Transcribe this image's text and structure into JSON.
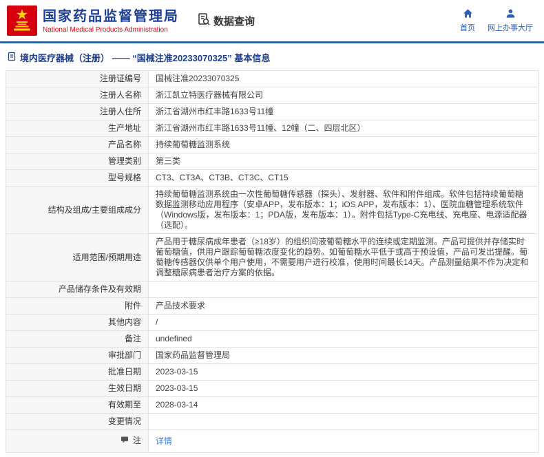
{
  "header": {
    "agency_cn": "国家药品监督管理局",
    "agency_en": "National Medical Products Administration",
    "data_query": "数据查询",
    "nav": {
      "home": "首页",
      "service_hall": "网上办事大厅"
    }
  },
  "breadcrumb": {
    "text": "境内医疗器械（注册） ——  “国械注准20233070325” 基本信息"
  },
  "table": {
    "rows": [
      {
        "label": "注册证编号",
        "value": "国械注准20233070325"
      },
      {
        "label": "注册人名称",
        "value": "浙江凯立特医疗器械有限公司"
      },
      {
        "label": "注册人住所",
        "value": "浙江省湖州市红丰路1633号11幢"
      },
      {
        "label": "生产地址",
        "value": "浙江省湖州市红丰路1633号11幢、12幢（二、四层北区）"
      },
      {
        "label": "产品名称",
        "value": "持续葡萄糖监测系统"
      },
      {
        "label": "管理类别",
        "value": "第三类"
      },
      {
        "label": "型号规格",
        "value": "CT3、CT3A、CT3B、CT3C、CT15"
      },
      {
        "label": "结构及组成/主要组成成分",
        "value": "持续葡萄糖监测系统由一次性葡萄糖传感器（探头）、发射器、软件和附件组成。软件包括持续葡萄糖数据监测移动应用程序（安卓APP，发布版本：1；iOS APP，发布版本：1）、医院血糖管理系统软件（Windows版，发布版本：1；PDA版，发布版本：1）。附件包括Type-C充电线、充电座、电源适配器（选配）。"
      },
      {
        "label": "适用范围/预期用途",
        "value": "产品用于糖尿病成年患者（≥18岁）的组织间液葡萄糖水平的连续或定期监测。产品可提供并存储实时葡萄糖值，供用户跟踪葡萄糖浓度变化的趋势。如葡萄糖水平低于或高于预设值，产品可发出提醒。葡萄糖传感器仅供单个用户使用，不需要用户进行校准，使用时间最长14天。产品测量结果不作为决定和调整糖尿病患者治疗方案的依据。"
      },
      {
        "label": "产品储存条件及有效期",
        "value": ""
      },
      {
        "label": "附件",
        "value": "产品技术要求"
      },
      {
        "label": "其他内容",
        "value": "/"
      },
      {
        "label": "备注",
        "value": "undefined"
      },
      {
        "label": "审批部门",
        "value": "国家药品监督管理局"
      },
      {
        "label": "批准日期",
        "value": "2023-03-15"
      },
      {
        "label": "生效日期",
        "value": "2023-03-15"
      },
      {
        "label": "有效期至",
        "value": "2028-03-14"
      },
      {
        "label": "变更情况",
        "value": ""
      }
    ],
    "note_row": {
      "label": "注",
      "link": "详情"
    }
  },
  "colors": {
    "brand_red": "#d7000f",
    "title_blue": "#1c3f94",
    "subtitle_red": "#e60012",
    "nav_blue": "#2b5fb8",
    "divider_blue": "#2d66a5",
    "link_blue": "#3579d8",
    "label_bg": "#f7f7f7"
  }
}
